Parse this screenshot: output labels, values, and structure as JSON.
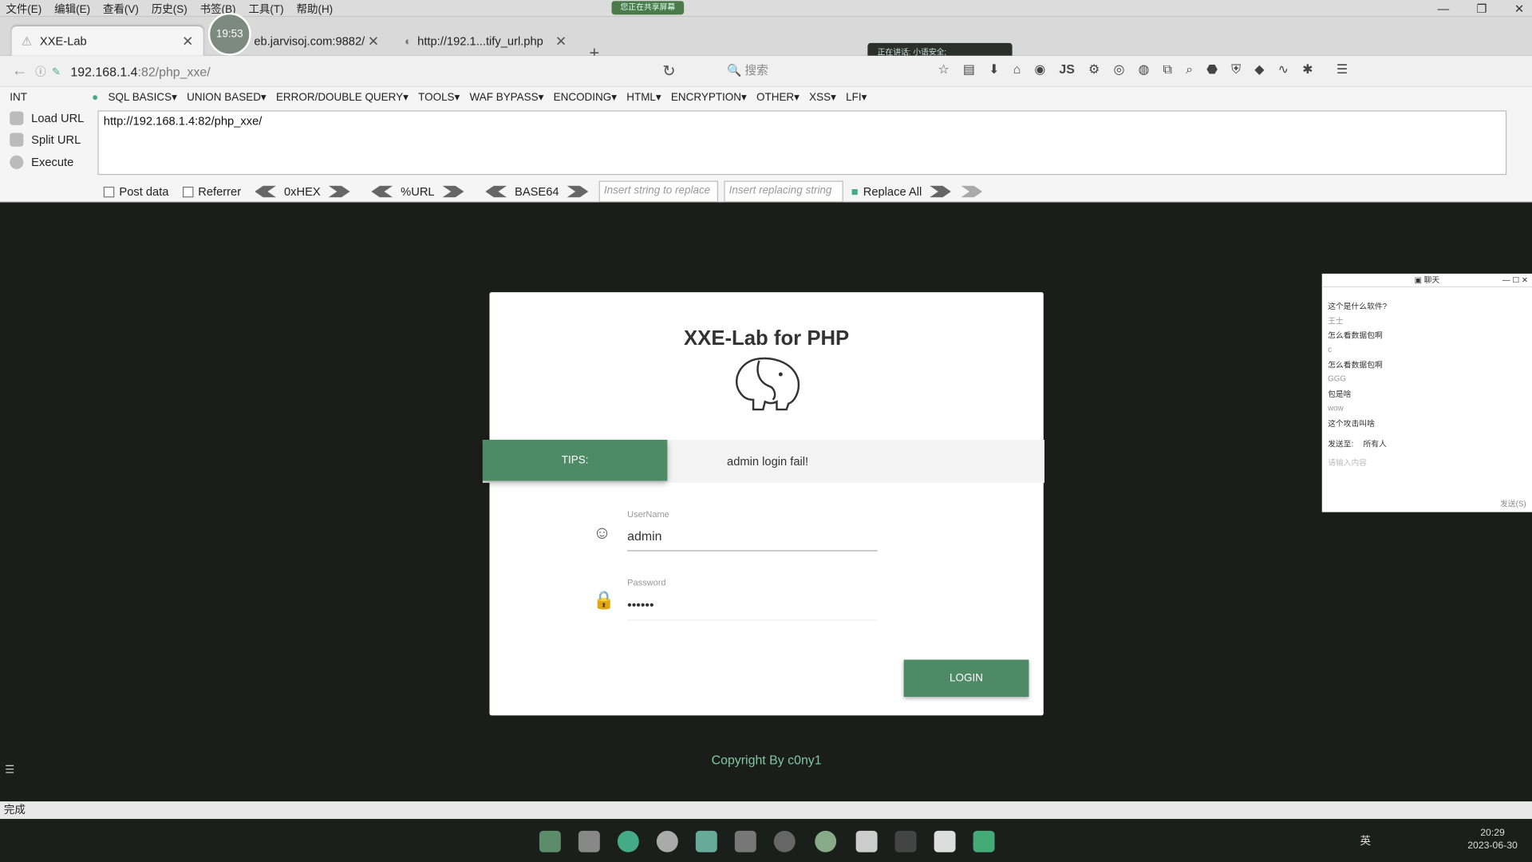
{
  "menu": [
    "文件(E)",
    "编辑(E)",
    "查看(V)",
    "历史(S)",
    "书签(B)",
    "工具(T)",
    "帮助(H)"
  ],
  "recording": "您正在共享屏幕",
  "tabs": [
    {
      "label": "XXE-Lab"
    },
    {
      "label": "eb.jarvisoj.com:9882/"
    },
    {
      "label": "http://192.1...tify_url.php"
    }
  ],
  "clock": "19:53",
  "voice": "正在讲话: 小语安全;",
  "url": {
    "host": "192.168.1.4",
    "path": ":82/php_xxe/"
  },
  "search_placeholder": "搜索",
  "hackbar": {
    "select": "INT",
    "menus": [
      "SQL BASICS▾",
      "UNION BASED▾",
      "ERROR/DOUBLE QUERY▾",
      "TOOLS▾",
      "WAF BYPASS▾",
      "ENCODING▾",
      "HTML▾",
      "ENCRYPTION▾",
      "OTHER▾",
      "XSS▾",
      "LFI▾"
    ],
    "load": "Load URL",
    "split": "Split URL",
    "execute": "Execute",
    "url_value": "http://192.168.1.4:82/php_xxe/",
    "post": "Post data",
    "referrer": "Referrer",
    "hex": "0xHEX",
    "urlenc": "%URL",
    "b64": "BASE64",
    "find_ph": "Insert string to replace",
    "replace_ph": "Insert replacing string",
    "replace_all": "Replace All"
  },
  "page": {
    "title": "XXE-Lab for PHP",
    "tips": "TIPS:",
    "tip_msg": "admin login fail!",
    "user_label": "UserName",
    "user_value": "admin",
    "pass_label": "Password",
    "pass_value": "••••••",
    "login": "LOGIN",
    "copyright": "Copyright By c0ny1"
  },
  "chat": {
    "title": "聊天",
    "messages": [
      "这个是什么软件?",
      "王士",
      "怎么看数据包啊",
      "c",
      "怎么看数据包啊",
      "GGG",
      "包是啥",
      "wow",
      "这个攻击叫啥"
    ],
    "send_to": "发送至:",
    "to_all": "所有人",
    "input_ph": "请输入内容",
    "send": "发送(S)"
  },
  "status": "完成",
  "time": "20:29",
  "date": "2023-06-30",
  "ime": "英"
}
